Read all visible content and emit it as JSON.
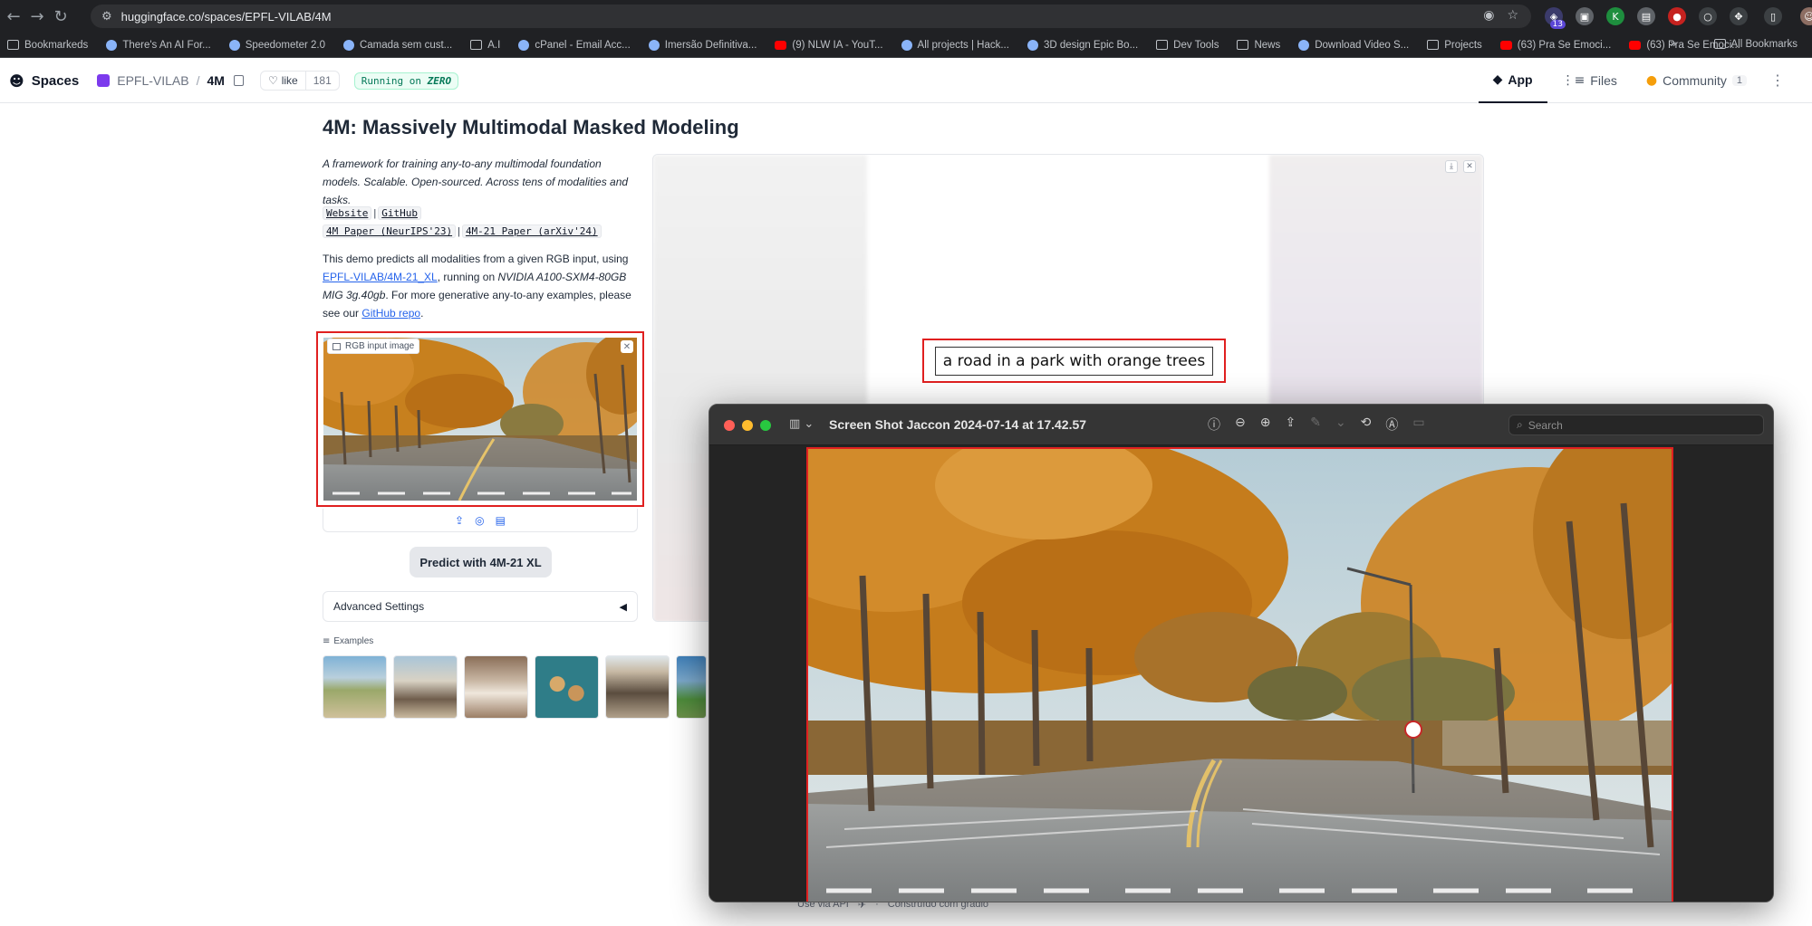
{
  "browser": {
    "url": "huggingface.co/spaces/EPFL-VILAB/4M",
    "extension_badge": "13",
    "bookmarks": [
      {
        "label": "Bookmarkeds",
        "icon": "folder-icon"
      },
      {
        "label": "There's An AI For...",
        "icon": "site-icon"
      },
      {
        "label": "Speedometer 2.0",
        "icon": "site-icon"
      },
      {
        "label": "Camada sem cust...",
        "icon": "site-icon"
      },
      {
        "label": "A.I",
        "icon": "folder-icon"
      },
      {
        "label": "cPanel - Email Acc...",
        "icon": "site-icon"
      },
      {
        "label": "Imersão Definitiva...",
        "icon": "site-icon"
      },
      {
        "label": "(9) NLW IA - YouT...",
        "icon": "youtube-icon"
      },
      {
        "label": "All projects | Hack...",
        "icon": "site-icon"
      },
      {
        "label": "3D design Epic Bo...",
        "icon": "site-icon"
      },
      {
        "label": "Dev Tools",
        "icon": "folder-icon"
      },
      {
        "label": "News",
        "icon": "folder-icon"
      },
      {
        "label": "Download Video S...",
        "icon": "site-icon"
      },
      {
        "label": "Projects",
        "icon": "folder-icon"
      },
      {
        "label": "(63) Pra Se Emoci...",
        "icon": "youtube-icon"
      },
      {
        "label": "(63) Pra Se Emoci...",
        "icon": "youtube-icon"
      }
    ],
    "all_bookmarks": "All Bookmarks"
  },
  "hf": {
    "spaces": "Spaces",
    "org": "EPFL-VILAB",
    "space": "4M",
    "like": "like",
    "likes": "181",
    "running_prefix": "Running on",
    "running_hw": "ZERO",
    "tabs": [
      {
        "label": "App",
        "count": ""
      },
      {
        "label": "Files",
        "count": ""
      },
      {
        "label": "Community",
        "count": "1"
      }
    ]
  },
  "app": {
    "title": "4M: Massively Multimodal Masked Modeling",
    "tagline": "A framework for training any-to-any multimodal foundation models. Scalable. Open-sourced. Across tens of modalities and tasks.",
    "links": {
      "website": "Website",
      "github": "GitHub",
      "paper1": "4M Paper (NeurIPS'23)",
      "paper2": "4M-21 Paper (arXiv'24)"
    },
    "demo": {
      "part1": "This demo predicts all modalities from a given RGB input, using ",
      "model_link": "EPFL-VILAB/4M-21_XL",
      "part2": ", running on ",
      "hardware": "NVIDIA A100-SXM4-80GB MIG 3g.40gb",
      "part3": ". For more generative any-to-any examples, please see our ",
      "repo_link": "GitHub repo",
      "part4": "."
    },
    "input_label": "RGB input image",
    "predict_button": "Predict with 4M-21 XL",
    "advanced_settings": "Advanced Settings",
    "examples_label": "Examples",
    "caption": "a road in a park with orange trees",
    "footer_api": "Use via API",
    "footer_built": "Construído com gradio"
  },
  "preview": {
    "title": "Screen Shot Jaccon 2024-07-14 at 17.42.57",
    "search_placeholder": "Search"
  },
  "colors": {
    "highlight_red": "#e02020",
    "link_blue": "#2563eb",
    "browser_dark": "#202124",
    "preview_dark": "#2b2b2b"
  }
}
